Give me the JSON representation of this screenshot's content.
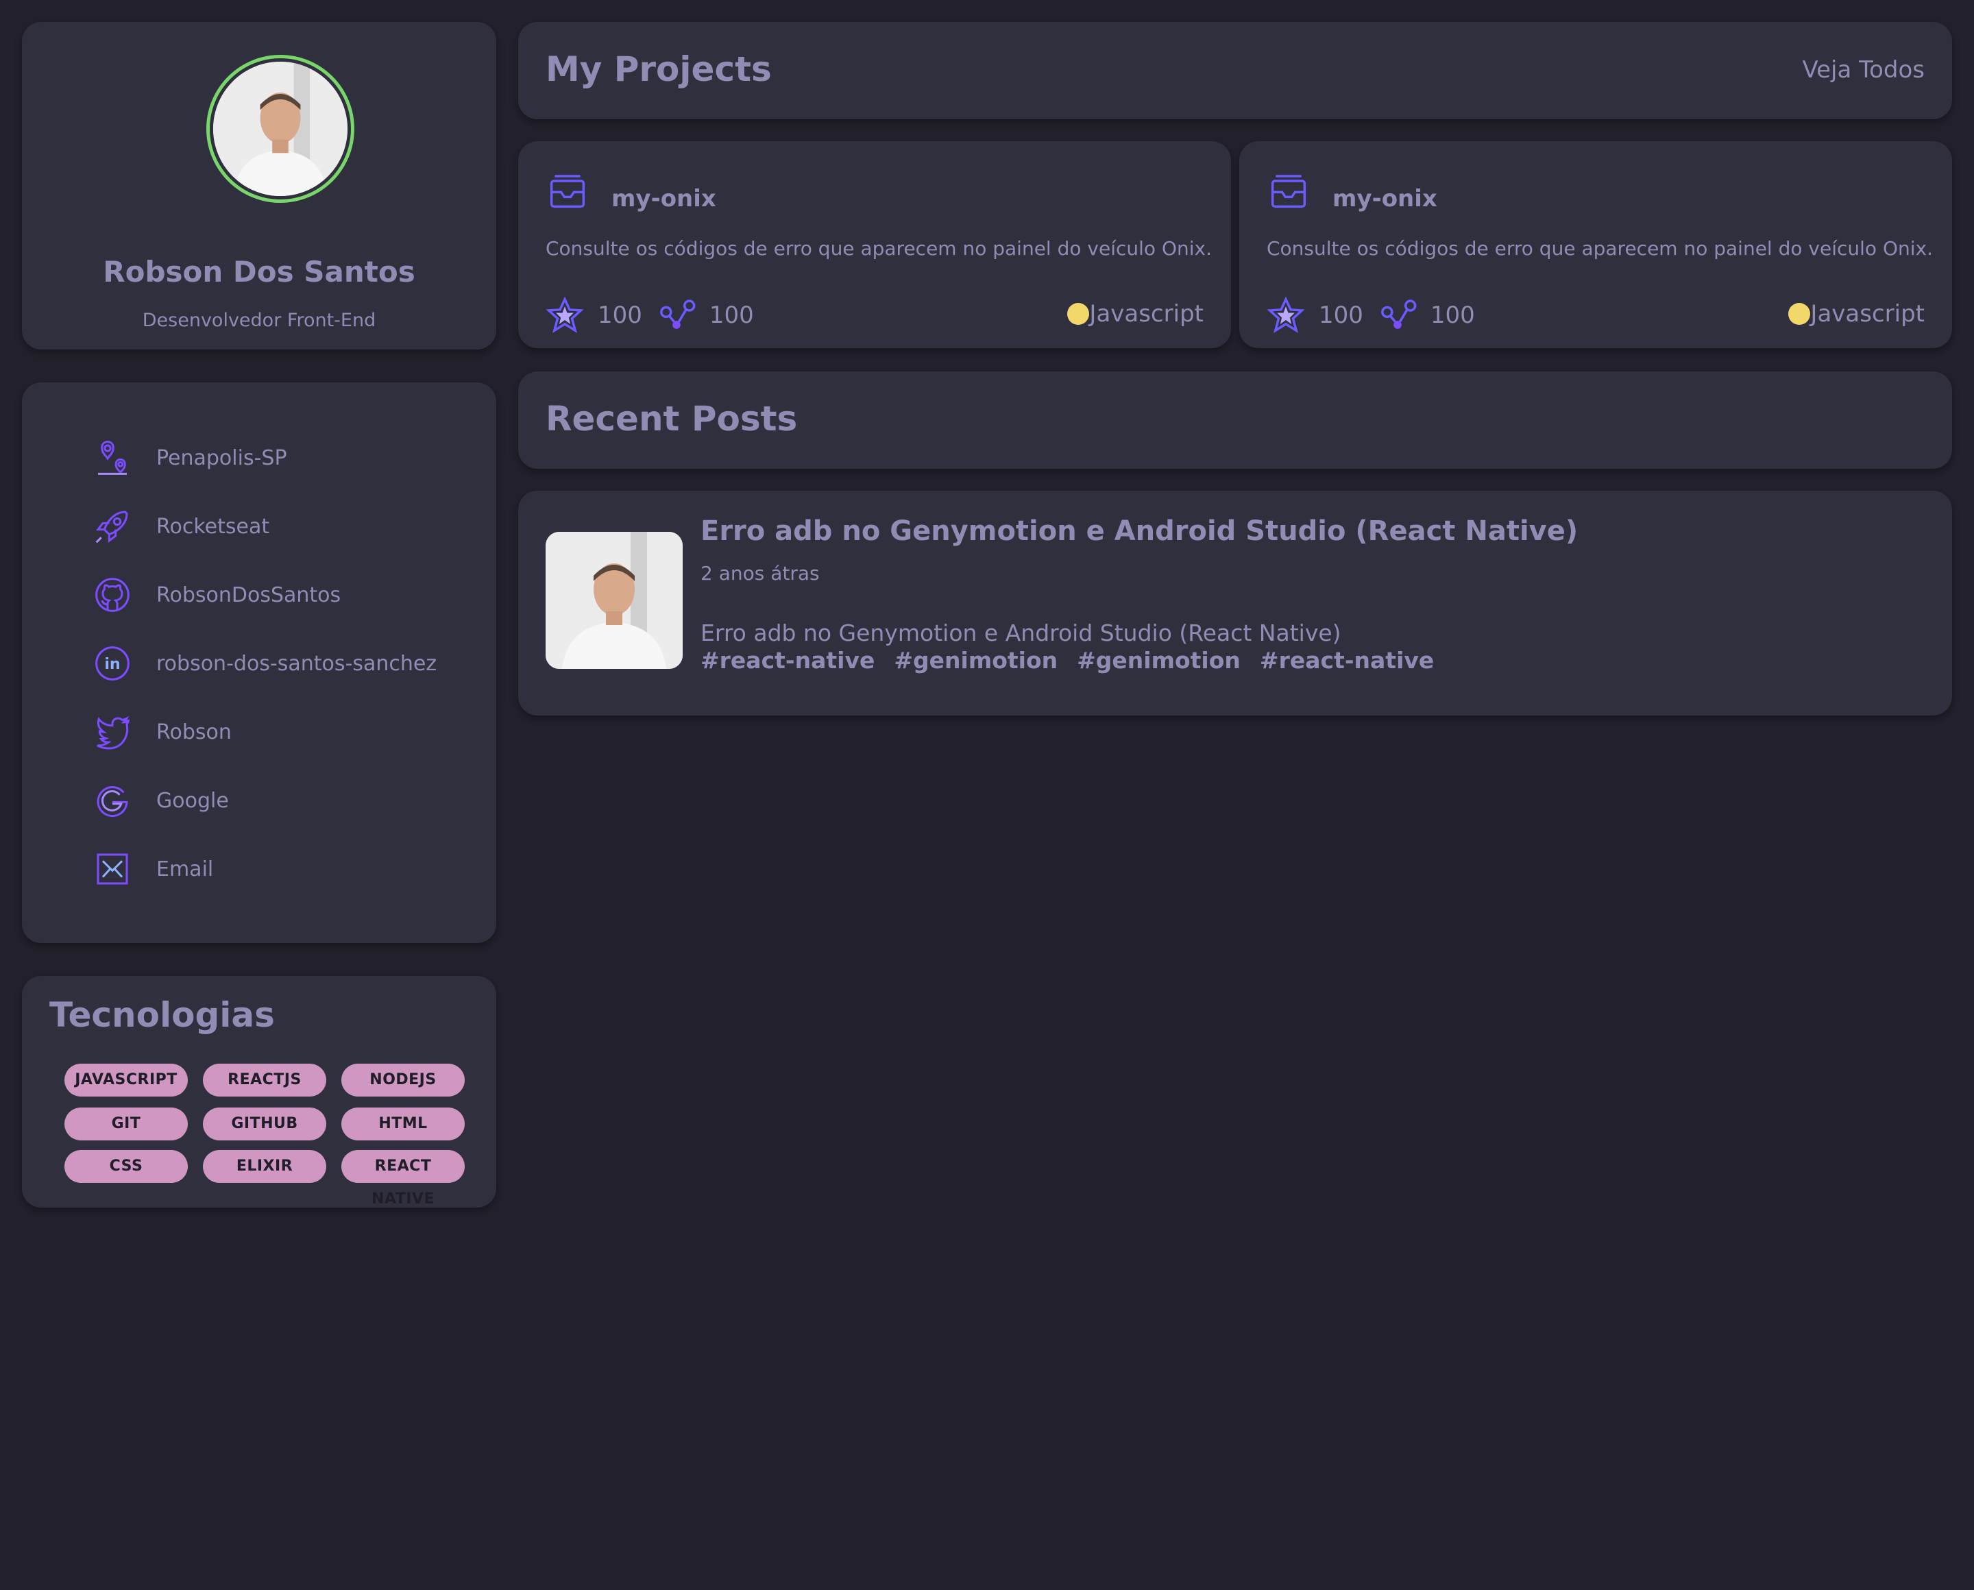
{
  "profile": {
    "name": "Robson Dos Santos",
    "role": "Desenvolvedor Front-End"
  },
  "contacts": [
    {
      "label": "Penapolis-SP",
      "icon": "location-pin-icon"
    },
    {
      "label": "Rocketseat",
      "icon": "rocket-icon"
    },
    {
      "label": "RobsonDosSantos",
      "icon": "github-icon"
    },
    {
      "label": "robson-dos-santos-sanchez",
      "icon": "linkedin-icon"
    },
    {
      "label": "Robson",
      "icon": "twitter-icon"
    },
    {
      "label": "Google",
      "icon": "google-icon"
    },
    {
      "label": "Email",
      "icon": "email-icon"
    }
  ],
  "technologies": {
    "title": "Tecnologias",
    "tags": [
      "JAVASCRIPT",
      "REACTJS",
      "NODEJS",
      "GIT",
      "GITHUB",
      "HTML",
      "CSS",
      "ELIXIR",
      "REACT NATIVE"
    ]
  },
  "projects": {
    "title": "My Projects",
    "see_all": "Veja Todos",
    "items": [
      {
        "name": "my-onix",
        "description": "Consulte os códigos de erro que aparecem no painel do veículo Onix.",
        "stars": "100",
        "forks": "100",
        "language": "Javascript",
        "language_color": "#f2d86a"
      },
      {
        "name": "my-onix",
        "description": "Consulte os códigos de erro que aparecem no painel do veículo Onix.",
        "stars": "100",
        "forks": "100",
        "language": "Javascript",
        "language_color": "#f2d86a"
      }
    ]
  },
  "posts": {
    "title": "Recent Posts",
    "items": [
      {
        "title": "Erro adb no Genymotion e Android Studio (React Native)",
        "date": "2 anos átras",
        "excerpt": "Erro adb no Genymotion e Android Studio (React Native)",
        "tags": [
          "#react-native",
          "#genimotion",
          "#genimotion",
          "#react-native"
        ]
      }
    ]
  },
  "colors": {
    "background": "#22212c",
    "card": "#302f3d",
    "text": "#8f8db4",
    "accent_icon": "#7b4dff",
    "tag_background": "#cf97c1",
    "avatar_ring": "#78d66a"
  }
}
